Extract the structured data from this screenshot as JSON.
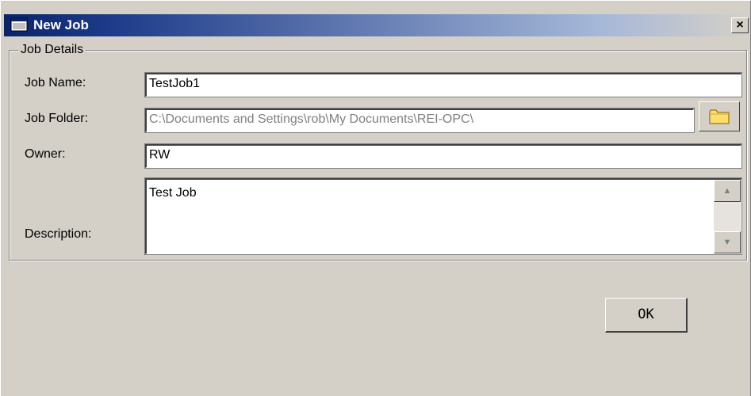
{
  "window": {
    "title": "New Job",
    "close_label": "×"
  },
  "group": {
    "legend": "Job Details"
  },
  "form": {
    "job_name": {
      "label": "Job Name:",
      "value": "TestJob1"
    },
    "job_folder": {
      "label": "Job Folder:",
      "value": "C:\\Documents and Settings\\rob\\My Documents\\REI-OPC\\"
    },
    "owner": {
      "label": "Owner:",
      "value": "RW"
    },
    "description": {
      "label": "Description:",
      "value": "Test Job"
    }
  },
  "buttons": {
    "ok_label": "OK"
  },
  "icons": {
    "app": "window-icon",
    "folder": "folder-icon",
    "scroll_up": "scroll-up-icon",
    "scroll_down": "scroll-down-icon"
  },
  "colors": {
    "title_start": "#0a246a",
    "title_end": "#d4d0c8",
    "dialog_bg": "#d4d0c8",
    "folder_yellow": "#ffde6b"
  }
}
